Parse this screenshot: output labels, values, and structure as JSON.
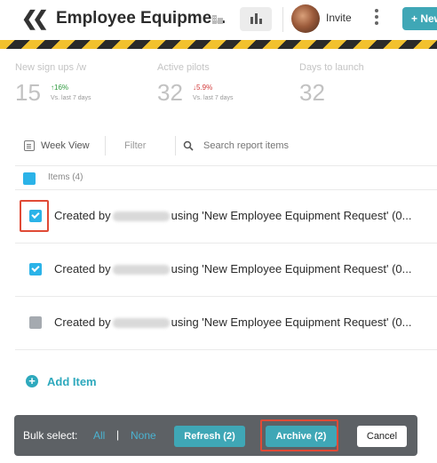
{
  "header": {
    "back_glyph": "❮❮",
    "title": "Employee Equipme...",
    "invite_label": "Invite",
    "new_button_label": "+ New"
  },
  "stats": [
    {
      "label": "New sign ups /w",
      "value": "15",
      "change": "↑16%",
      "direction": "up",
      "sub": "Vs. last 7 days"
    },
    {
      "label": "Active pilots",
      "value": "32",
      "change": "↓5.9%",
      "direction": "down",
      "sub": "Vs. last 7 days"
    },
    {
      "label": "Days to launch",
      "value": "32"
    }
  ],
  "toolbar": {
    "week_view_label": "Week View",
    "filter_label": "Filter",
    "search_placeholder": "Search report items"
  },
  "items_header": {
    "label": "Items (4)"
  },
  "rows": [
    {
      "prefix": "Created by",
      "suffix": "using 'New Employee Equipment Request' (0...",
      "checked": true
    },
    {
      "prefix": "Created by",
      "suffix": "using 'New Employee Equipment Request' (0...",
      "checked": true
    },
    {
      "prefix": "Created by",
      "suffix": "using 'New Employee Equipment Request' (0...",
      "checked": false
    }
  ],
  "add_item_label": "Add Item",
  "bulk": {
    "label": "Bulk select:",
    "all": "All",
    "separator": "|",
    "none": "None",
    "refresh_label": "Refresh (2)",
    "archive_label": "Archive (2)",
    "cancel_label": "Cancel"
  },
  "colors": {
    "accent": "#3fa7b6",
    "checkbox_blue": "#2bb3e8",
    "highlight_red": "#e04a36",
    "bulk_bar": "#5d6165"
  }
}
